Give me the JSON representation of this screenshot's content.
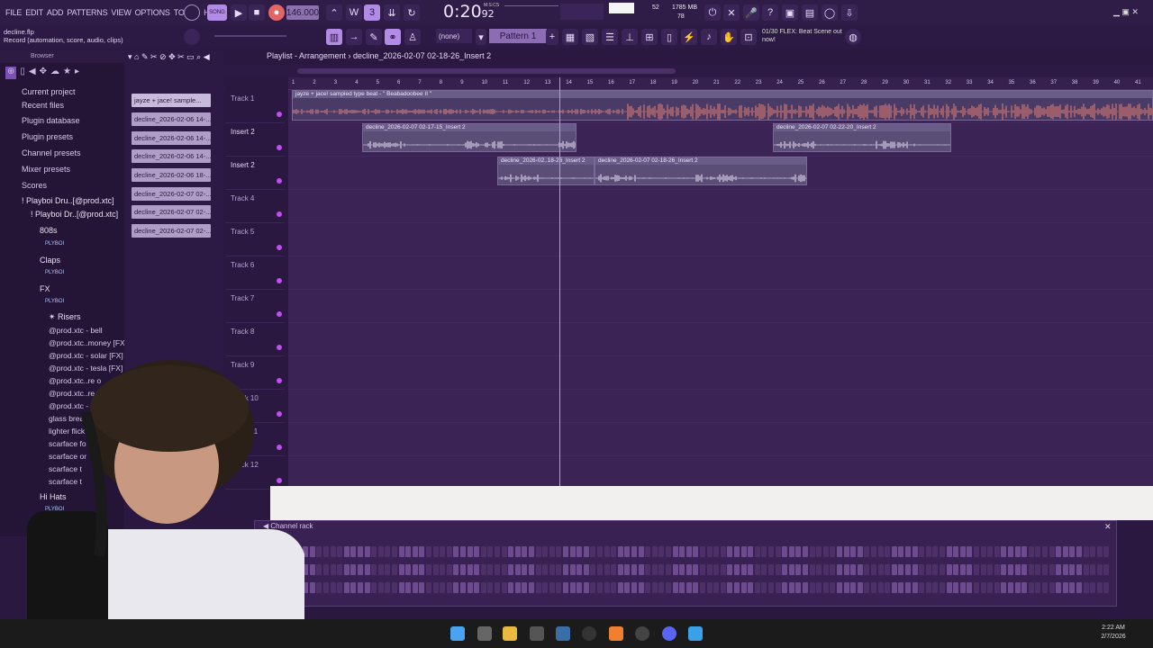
{
  "menu": [
    "FILE",
    "EDIT",
    "ADD",
    "PATTERNS",
    "VIEW",
    "OPTIONS",
    "TOOLS",
    "HELP"
  ],
  "tempo": "146.000",
  "clock": {
    "main": "0:20",
    "sub": "92",
    "label": "M:S:CS"
  },
  "memory": {
    "cpu": "52",
    "ram": "1785 MB",
    "poly": "78"
  },
  "hint": {
    "file": "decline.flp",
    "text": "Record  (automation, score, audio, clips)"
  },
  "pattern_select": "Pattern 1",
  "none_select": "(none)",
  "news": {
    "count": "01/30",
    "text": "FLEX: Beat Scene out now!"
  },
  "browser": {
    "title": "Browser",
    "items": [
      "Current project",
      "Recent files",
      "Plugin database",
      "Plugin presets",
      "Channel presets",
      "Mixer presets",
      "Scores"
    ],
    "tree": [
      "! Playboi Dru..[@prod.xtc]",
      "! Playboi Dr..[@prod.xtc]"
    ],
    "folders": [
      "808s",
      "Claps",
      "FX",
      "✴ Risers",
      "Hi Hats"
    ],
    "tag": "PLYBOI",
    "samples": [
      "@prod.xtc - bell",
      "@prod.xtc..money [FX]",
      "@prod.xtc - solar [FX]",
      "@prod.xtc - tesla [FX]",
      "@prod.xtc..re o",
      "@prod.xtc..re",
      "@prod.xtc - v",
      "glass break",
      "lighter flick",
      "scarface fo",
      "scarface or",
      "scarface t",
      "scarface t"
    ]
  },
  "patterns": [
    "jayze + jace! sample...",
    "decline_2026-02-06 14-...",
    "decline_2026-02-06 14-...",
    "decline_2026-02-06 14-...",
    "decline_2026-02-06 18-...",
    "decline_2026-02-07 02-...",
    "decline_2026-02-07 02-...",
    "decline_2026-02-07 02-..."
  ],
  "playlist": {
    "title": "Playlist - Arrangement › decline_2026-02-07 02-18-26_Insert 2",
    "ruler": [
      "1",
      "2",
      "3",
      "4",
      "5",
      "6",
      "7",
      "8",
      "9",
      "10",
      "11",
      "12",
      "13",
      "14",
      "15",
      "16",
      "17",
      "18",
      "19",
      "20",
      "21",
      "22",
      "23",
      "24",
      "25",
      "26",
      "27",
      "28",
      "29",
      "30",
      "31",
      "32",
      "33",
      "34",
      "35",
      "36",
      "37",
      "38",
      "39",
      "40",
      "41"
    ],
    "tracks": [
      "Track 1",
      "Insert 2",
      "Insert 2",
      "Track 4",
      "Track 5",
      "Track 6",
      "Track 7",
      "Track 8",
      "Track 9",
      "Track 10",
      "Track 11",
      "Track 12"
    ],
    "clips": [
      {
        "label": "jayze + jace! sampled type beat - \" Beabadoobee II \""
      },
      {
        "label": "decline_2026-02-07 02-17-15_Insert 2"
      },
      {
        "label": "decline_2026-02-07 02-22-20_Insert 2"
      },
      {
        "label": "decline_2026-02..18-26_Insert 2"
      },
      {
        "label": "decline_2026-02-07 02-18-26_Insert 2"
      }
    ]
  },
  "channel_rack": {
    "title": "Channel rack"
  },
  "taskbar": {
    "time": "2:22 AM",
    "date": "2/7/2026"
  },
  "colors": {
    "accent": "#b28be6",
    "background": "#2a1840",
    "clip_audio": "#e07a7a"
  }
}
